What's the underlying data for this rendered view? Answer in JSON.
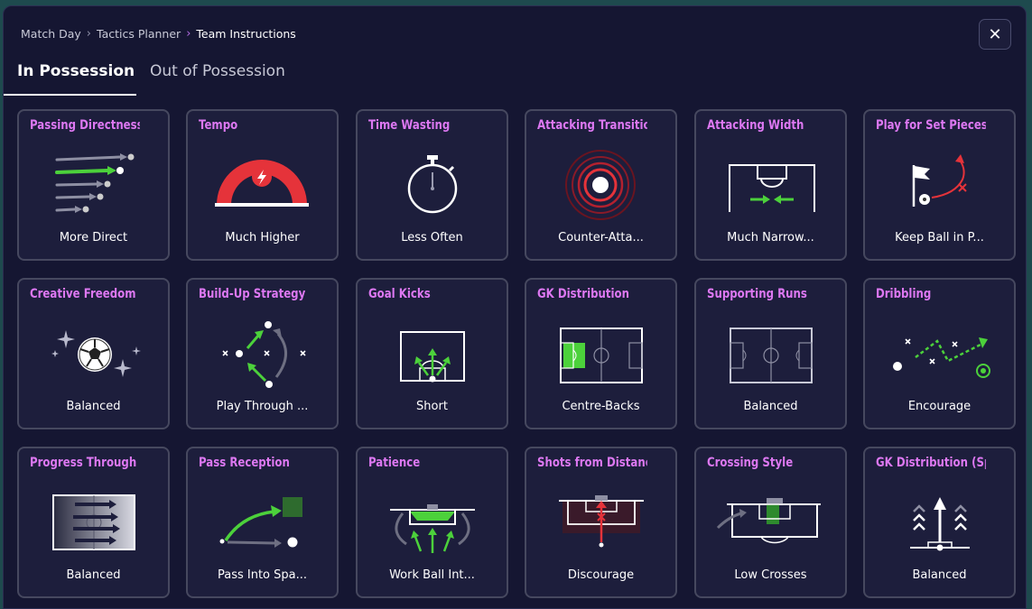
{
  "breadcrumb": [
    "Match Day",
    "Tactics Planner",
    "Team Instructions"
  ],
  "tabs": {
    "in_possession": "In Possession",
    "out_of_possession": "Out of Possession"
  },
  "colors": {
    "title": "#dd78f2",
    "accent_green": "#4cd13b",
    "accent_red": "#e5333a",
    "card_bg": "#1d1e3c",
    "card_border": "#46485f",
    "modal_bg": "#151632"
  },
  "cards": [
    {
      "title": "Passing Directness",
      "value": "More Direct",
      "icon": "passing-arrows-icon"
    },
    {
      "title": "Tempo",
      "value": "Much Higher",
      "icon": "tempo-gauge-icon"
    },
    {
      "title": "Time Wasting",
      "value": "Less Often",
      "icon": "stopwatch-icon"
    },
    {
      "title": "Attacking Transition",
      "value": "Counter-Atta...",
      "icon": "counter-attack-target-icon"
    },
    {
      "title": "Attacking Width",
      "value": "Much Narrow...",
      "icon": "attacking-width-pitch-icon"
    },
    {
      "title": "Play for Set Pieces",
      "value": "Keep Ball in P...",
      "icon": "set-piece-flag-icon"
    },
    {
      "title": "Creative Freedom",
      "value": "Balanced",
      "icon": "sparkle-ball-icon"
    },
    {
      "title": "Build-Up Strategy",
      "value": "Play Through ...",
      "icon": "build-up-arrows-icon"
    },
    {
      "title": "Goal Kicks",
      "value": "Short",
      "icon": "goal-kick-box-icon"
    },
    {
      "title": "GK Distribution",
      "value": "Centre-Backs",
      "icon": "gk-distribution-pitch-icon"
    },
    {
      "title": "Supporting Runs",
      "value": "Balanced",
      "icon": "supporting-runs-pitch-icon"
    },
    {
      "title": "Dribbling",
      "value": "Encourage",
      "icon": "dribbling-path-icon"
    },
    {
      "title": "Progress Through",
      "value": "Balanced",
      "icon": "progress-pitch-icon"
    },
    {
      "title": "Pass Reception",
      "value": "Pass Into Spa...",
      "icon": "pass-reception-icon"
    },
    {
      "title": "Patience",
      "value": "Work Ball Int...",
      "icon": "patience-box-icon"
    },
    {
      "title": "Shots from Distance",
      "value": "Discourage",
      "icon": "shots-distance-icon"
    },
    {
      "title": "Crossing Style",
      "value": "Low Crosses",
      "icon": "crossing-style-icon"
    },
    {
      "title": "GK Distribution (Speed",
      "value": "Balanced",
      "icon": "gk-speed-arrows-icon"
    }
  ]
}
